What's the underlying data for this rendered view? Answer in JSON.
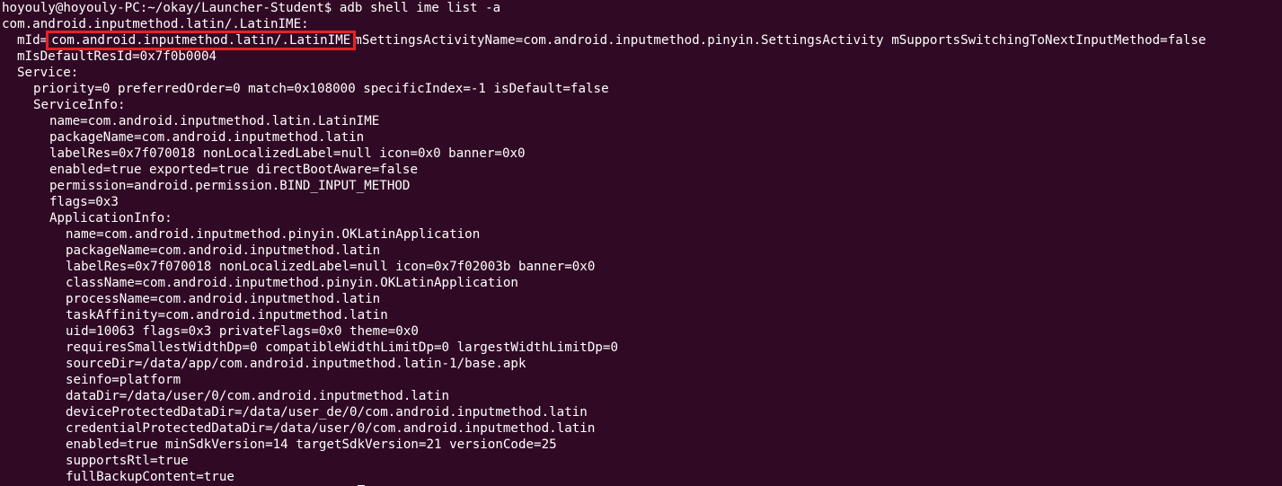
{
  "prompt": {
    "user_host": "hoyouly@hoyouly-PC",
    "path": ":~/okay/Launcher-Student$",
    "command": " adb shell ime list -a"
  },
  "lines": [
    {
      "indent": 0,
      "text": "com.android.inputmethod.latin/.LatinIME:"
    },
    {
      "indent": 1,
      "prefix": "mId=",
      "highlighted": "com.android.inputmethod.latin/.LatinIME",
      "suffix": "mSettingsActivityName=com.android.inputmethod.pinyin.SettingsActivity mSupportsSwitchingToNextInputMethod=false"
    },
    {
      "indent": 1,
      "text": "mIsDefaultResId=0x7f0b0004"
    },
    {
      "indent": 1,
      "text": "Service:"
    },
    {
      "indent": 2,
      "text": "priority=0 preferredOrder=0 match=0x108000 specificIndex=-1 isDefault=false"
    },
    {
      "indent": 2,
      "text": "ServiceInfo:"
    },
    {
      "indent": 3,
      "text": "name=com.android.inputmethod.latin.LatinIME"
    },
    {
      "indent": 3,
      "text": "packageName=com.android.inputmethod.latin"
    },
    {
      "indent": 3,
      "text": "labelRes=0x7f070018 nonLocalizedLabel=null icon=0x0 banner=0x0"
    },
    {
      "indent": 3,
      "text": "enabled=true exported=true directBootAware=false"
    },
    {
      "indent": 3,
      "text": "permission=android.permission.BIND_INPUT_METHOD"
    },
    {
      "indent": 3,
      "text": "flags=0x3"
    },
    {
      "indent": 3,
      "text": "ApplicationInfo:"
    },
    {
      "indent": 4,
      "text": "name=com.android.inputmethod.pinyin.OKLatinApplication"
    },
    {
      "indent": 4,
      "text": "packageName=com.android.inputmethod.latin"
    },
    {
      "indent": 4,
      "text": "labelRes=0x7f070018 nonLocalizedLabel=null icon=0x7f02003b banner=0x0"
    },
    {
      "indent": 4,
      "text": "className=com.android.inputmethod.pinyin.OKLatinApplication"
    },
    {
      "indent": 4,
      "text": "processName=com.android.inputmethod.latin"
    },
    {
      "indent": 4,
      "text": "taskAffinity=com.android.inputmethod.latin"
    },
    {
      "indent": 4,
      "text": "uid=10063 flags=0x3 privateFlags=0x0 theme=0x0"
    },
    {
      "indent": 4,
      "text": "requiresSmallestWidthDp=0 compatibleWidthLimitDp=0 largestWidthLimitDp=0"
    },
    {
      "indent": 4,
      "text": "sourceDir=/data/app/com.android.inputmethod.latin-1/base.apk"
    },
    {
      "indent": 4,
      "text": "seinfo=platform"
    },
    {
      "indent": 4,
      "text": "dataDir=/data/user/0/com.android.inputmethod.latin"
    },
    {
      "indent": 4,
      "text": "deviceProtectedDataDir=/data/user_de/0/com.android.inputmethod.latin"
    },
    {
      "indent": 4,
      "text": "credentialProtectedDataDir=/data/user/0/com.android.inputmethod.latin"
    },
    {
      "indent": 4,
      "text": "enabled=true minSdkVersion=14 targetSdkVersion=21 versionCode=25"
    },
    {
      "indent": 4,
      "text": "supportsRtl=true"
    },
    {
      "indent": 4,
      "text": "fullBackupContent=true"
    }
  ],
  "colors": {
    "background": "#300a24",
    "text": "#ffffff",
    "highlight": "#e8202c"
  }
}
